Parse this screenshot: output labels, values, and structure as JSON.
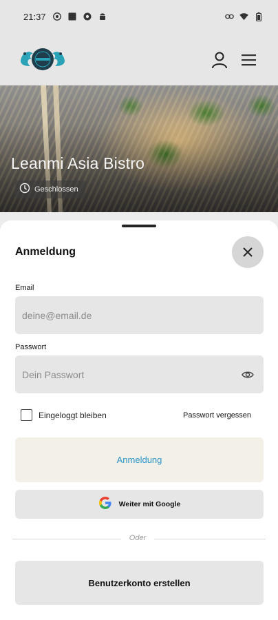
{
  "status_bar": {
    "time": "21:37",
    "icons_left": [
      "chrome-icon",
      "square-icon",
      "record-icon",
      "android-icon"
    ],
    "icons_right": [
      "link-icon",
      "wifi-icon",
      "battery-icon"
    ]
  },
  "header": {
    "logo": "dragon-logo",
    "icons": [
      "user-icon",
      "menu-icon"
    ]
  },
  "hero": {
    "title": "Leanmi Asia Bistro",
    "status": "Geschlossen"
  },
  "login_sheet": {
    "title": "Anmeldung",
    "email_label": "Email",
    "email_placeholder": "deine@email.de",
    "password_label": "Passwort",
    "password_placeholder": "Dein Passwort",
    "remember_label": "Eingeloggt bleiben",
    "forgot_label": "Passwort vergessen",
    "login_button": "Anmeldung",
    "google_button": "Weiter mit Google",
    "divider": "Oder",
    "register_button": "Benutzerkonto erstellen"
  },
  "colors": {
    "accent": "#2a93c9",
    "login_button_bg": "#f3f1e7",
    "field_bg": "#e6e6e6",
    "logo_teal": "#2aa3b8"
  }
}
